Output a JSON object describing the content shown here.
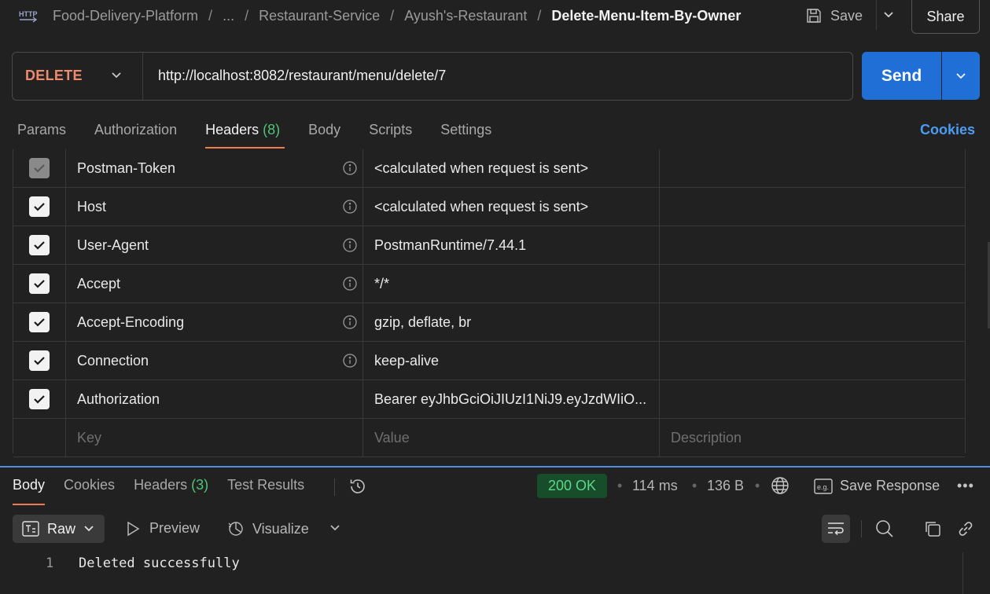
{
  "breadcrumb": {
    "items": [
      "Food-Delivery-Platform",
      "...",
      "Restaurant-Service",
      "Ayush's-Restaurant"
    ],
    "current": "Delete-Menu-Item-By-Owner",
    "separator": "/"
  },
  "toolbar": {
    "save_label": "Save",
    "share_label": "Share"
  },
  "request": {
    "method": "DELETE",
    "url": "http://localhost:8082/restaurant/menu/delete/7",
    "send_label": "Send"
  },
  "request_tabs": {
    "params": "Params",
    "authorization": "Authorization",
    "headers": "Headers",
    "headers_count": "(8)",
    "body": "Body",
    "scripts": "Scripts",
    "settings": "Settings",
    "cookies": "Cookies"
  },
  "headers_table": {
    "rows": [
      {
        "key": "Postman-Token",
        "value": "<calculated when request is sent>",
        "checked": true,
        "disabled": true,
        "info": true
      },
      {
        "key": "Host",
        "value": "<calculated when request is sent>",
        "checked": true,
        "disabled": false,
        "info": true
      },
      {
        "key": "User-Agent",
        "value": "PostmanRuntime/7.44.1",
        "checked": true,
        "disabled": false,
        "info": true
      },
      {
        "key": "Accept",
        "value": "*/*",
        "checked": true,
        "disabled": false,
        "info": true
      },
      {
        "key": "Accept-Encoding",
        "value": "gzip, deflate, br",
        "checked": true,
        "disabled": false,
        "info": true
      },
      {
        "key": "Connection",
        "value": "keep-alive",
        "checked": true,
        "disabled": false,
        "info": true
      },
      {
        "key": "Authorization",
        "value": "Bearer eyJhbGciOiJIUzI1NiJ9.eyJzdWIiO...",
        "checked": true,
        "disabled": false,
        "info": false
      }
    ],
    "placeholders": {
      "key": "Key",
      "value": "Value",
      "description": "Description"
    }
  },
  "response_tabs": {
    "body": "Body",
    "cookies": "Cookies",
    "headers": "Headers",
    "headers_count": "(3)",
    "test_results": "Test Results"
  },
  "response_meta": {
    "status": "200 OK",
    "time": "114 ms",
    "size": "136 B",
    "save_response": "Save Response",
    "eg_label": "e.g."
  },
  "response_toolbar": {
    "format": "Raw",
    "preview": "Preview",
    "visualize": "Visualize"
  },
  "response_body": {
    "lines": [
      {
        "number": "1",
        "text": "Deleted successfully"
      }
    ]
  },
  "colors": {
    "accent_blue": "#1f6fd6",
    "method_delete": "#f08a6d",
    "tab_underline": "#f07b52",
    "status_ok": "#5fd68a",
    "count_green": "#4fc477"
  }
}
